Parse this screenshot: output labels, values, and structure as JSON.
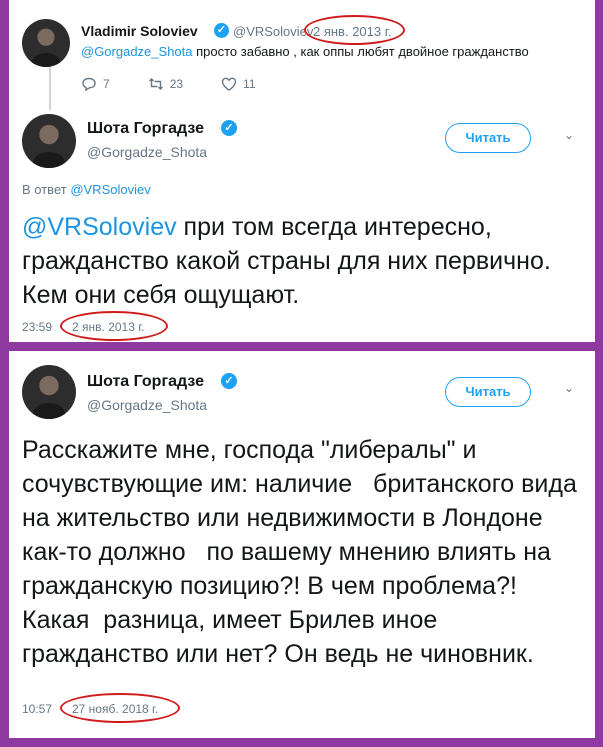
{
  "tweet1": {
    "name": "Vladimir Soloviev",
    "handle": "@VRSoloviev",
    "date": "2 янв. 2013 г.",
    "mention": "@Gorgadze_Shota",
    "text": " просто забавно , как оппы любят двойное гражданство",
    "reply_count": "7",
    "retweet_count": "23",
    "like_count": "11"
  },
  "tweet2": {
    "name": "Шота Горгадзе",
    "handle": "@Gorgadze_Shota",
    "follow_label": "Читать",
    "reply_to_prefix": "В ответ ",
    "reply_to_handle": "@VRSoloviev",
    "mention": "@VRSoloviev",
    "text": " при том всегда интересно, гражданство какой страны для них первично. Кем они себя ощущают.",
    "time": "23:59",
    "date": "2 янв. 2013 г."
  },
  "tweet3": {
    "name": "Шота Горгадзе",
    "handle": "@Gorgadze_Shota",
    "follow_label": "Читать",
    "text": "Расскажите мне, господа \"либералы\" и сочувствующие им: наличие   британского вида на жительство или недвижимости в Лондоне как-то должно   по вашему мнению влиять на гражданскую позицию?! В чем проблема?! Какая  разница, имеет Брилев иное гражданство или нет? Он ведь не чиновник.",
    "time": "10:57",
    "date": "27 нояб. 2018 г."
  },
  "colors": {
    "background": "#8e3aa0",
    "accent": "#1da1f2",
    "link": "#1b95e0",
    "muted": "#657786",
    "highlight_oval": "#d01b1b"
  },
  "icons": [
    "verified-badge",
    "reply-icon",
    "retweet-icon",
    "like-icon",
    "chevron-down-icon"
  ]
}
